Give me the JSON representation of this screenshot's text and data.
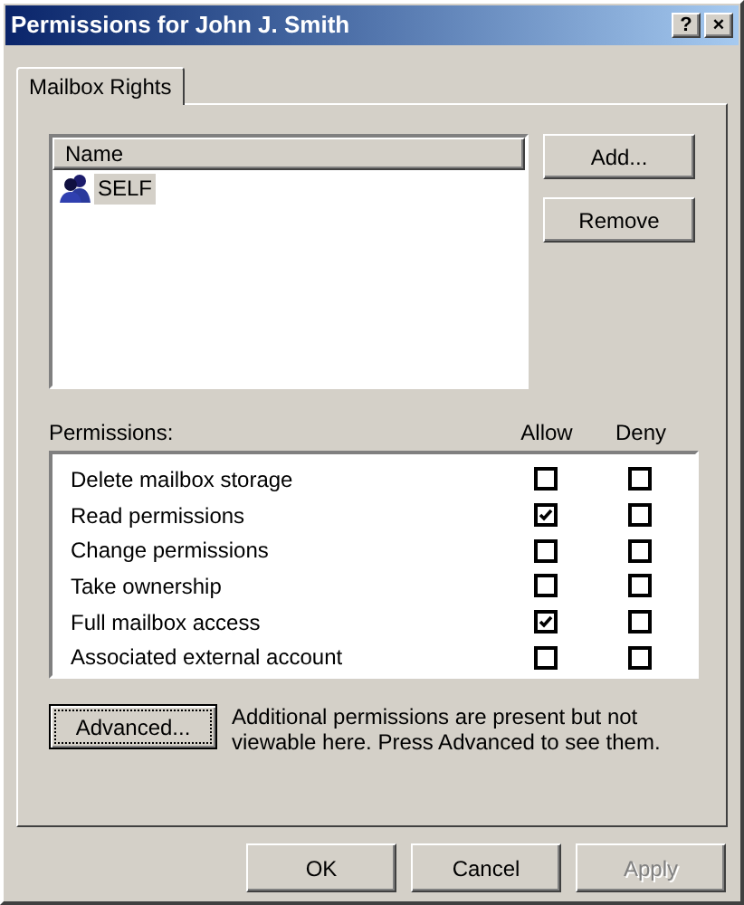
{
  "window": {
    "title": "Permissions for John J. Smith",
    "title_buttons": [
      "?",
      "×"
    ]
  },
  "tabs": [
    {
      "label": "Mailbox Rights",
      "selected": true
    }
  ],
  "accounts": {
    "columns": [
      "Name"
    ],
    "items": [
      {
        "name": "SELF",
        "selected": true
      }
    ]
  },
  "account_buttons": [
    {
      "label": "Add...",
      "disabled": false
    },
    {
      "label": "Remove",
      "disabled": false
    }
  ],
  "permissions": {
    "label": "Permissions:",
    "allow_heading": "Allow",
    "deny_heading": "Deny",
    "rows": [
      {
        "name": "Delete mailbox storage",
        "allow": false,
        "deny": false
      },
      {
        "name": "Read permissions",
        "allow": true,
        "deny": false
      },
      {
        "name": "Change permissions",
        "allow": false,
        "deny": false
      },
      {
        "name": "Take ownership",
        "allow": false,
        "deny": false
      },
      {
        "name": "Full mailbox access",
        "allow": true,
        "deny": false
      },
      {
        "name": "Associated external account",
        "allow": false,
        "deny": false
      }
    ]
  },
  "advanced": {
    "button": "Advanced...",
    "note": "Additional permissions are present but not viewable here. Press Advanced to see them."
  },
  "footer_buttons": [
    {
      "label": "OK",
      "disabled": false
    },
    {
      "label": "Cancel",
      "disabled": false
    },
    {
      "label": "Apply",
      "disabled": true
    }
  ]
}
